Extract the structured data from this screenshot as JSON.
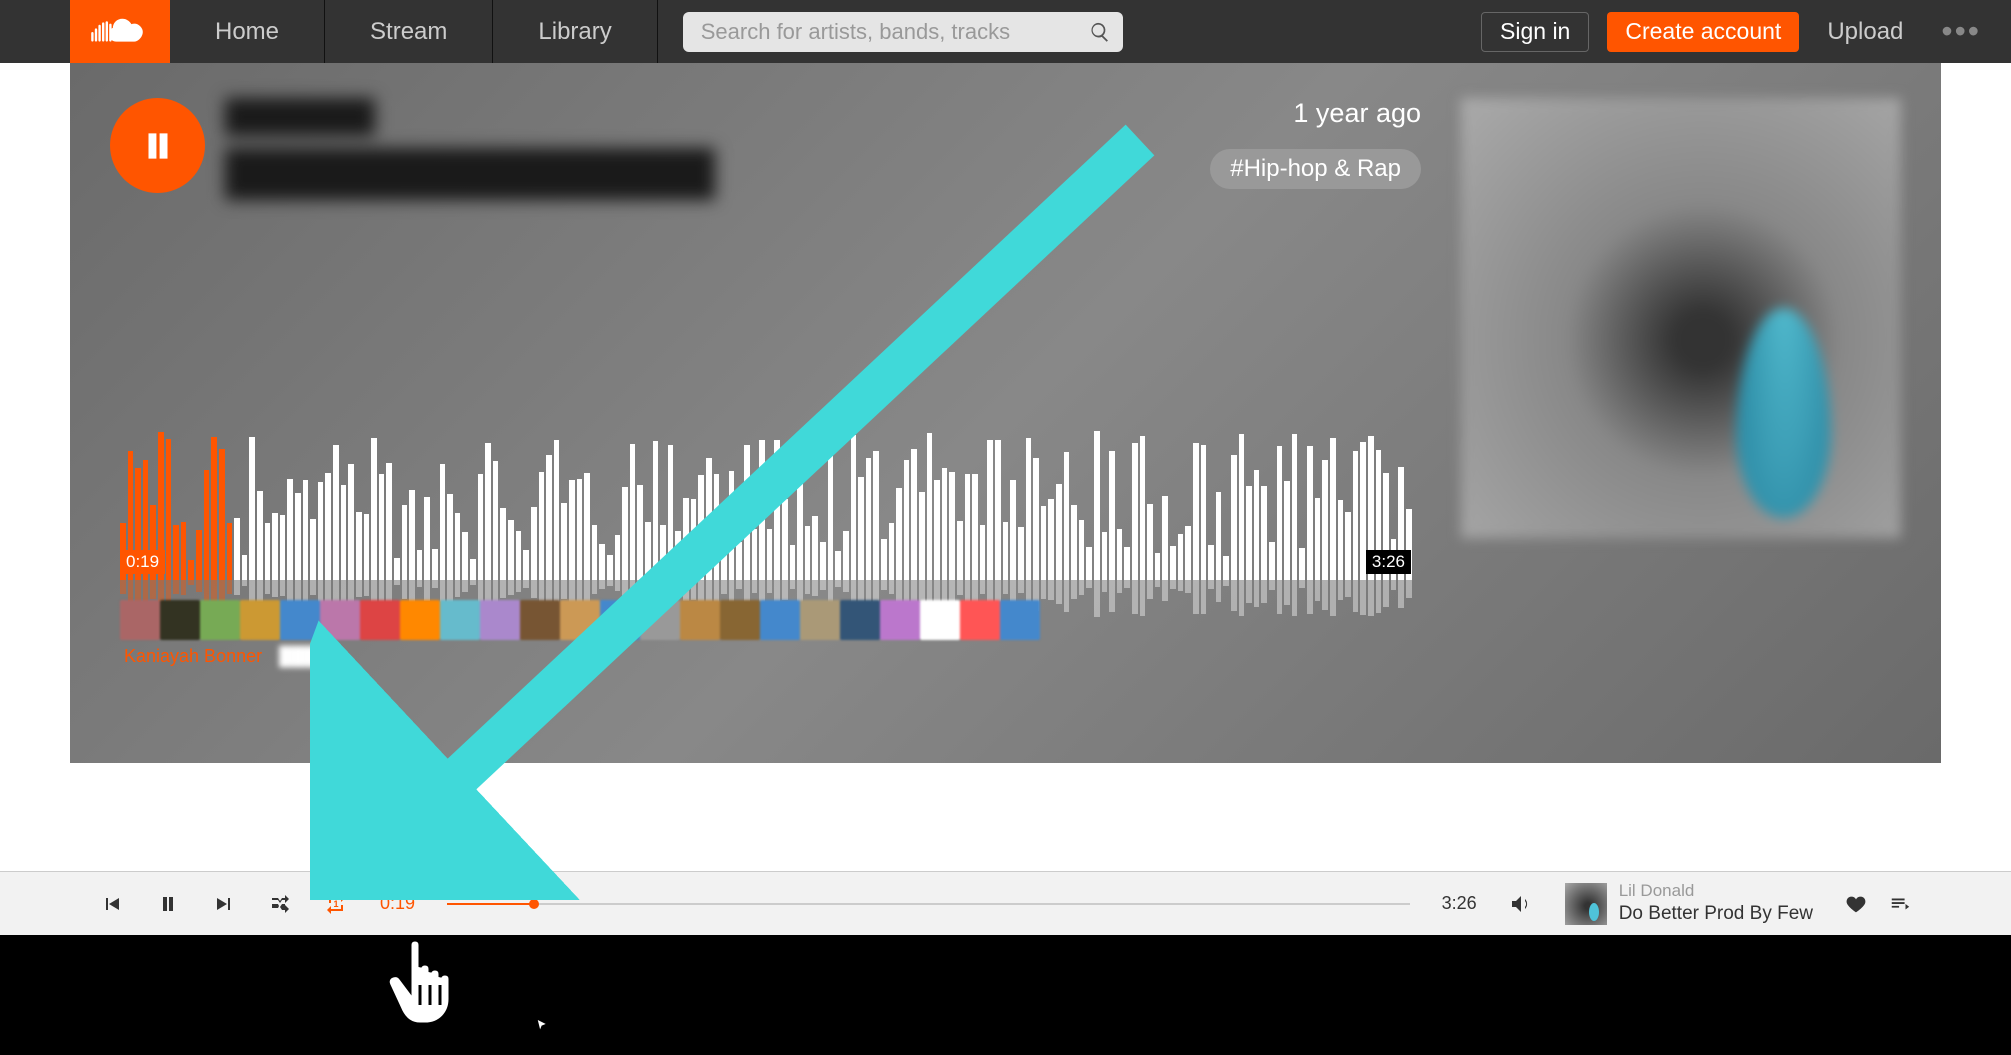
{
  "nav": {
    "tabs": [
      "Home",
      "Stream",
      "Library"
    ],
    "search_placeholder": "Search for artists, bands, tracks",
    "signin": "Sign in",
    "signup": "Create account",
    "upload": "Upload"
  },
  "hero": {
    "age": "1 year ago",
    "genre": "#Hip-hop & Rap",
    "time_current": "0:19",
    "time_total": "3:26",
    "commenter1": "Kaniayah Bonner"
  },
  "player": {
    "time_current": "0:19",
    "time_total": "3:26",
    "artist": "Lil Donald",
    "title": "Do Better Prod By Few"
  },
  "colors": {
    "accent": "#f50",
    "arrow": "#40d9d9"
  }
}
